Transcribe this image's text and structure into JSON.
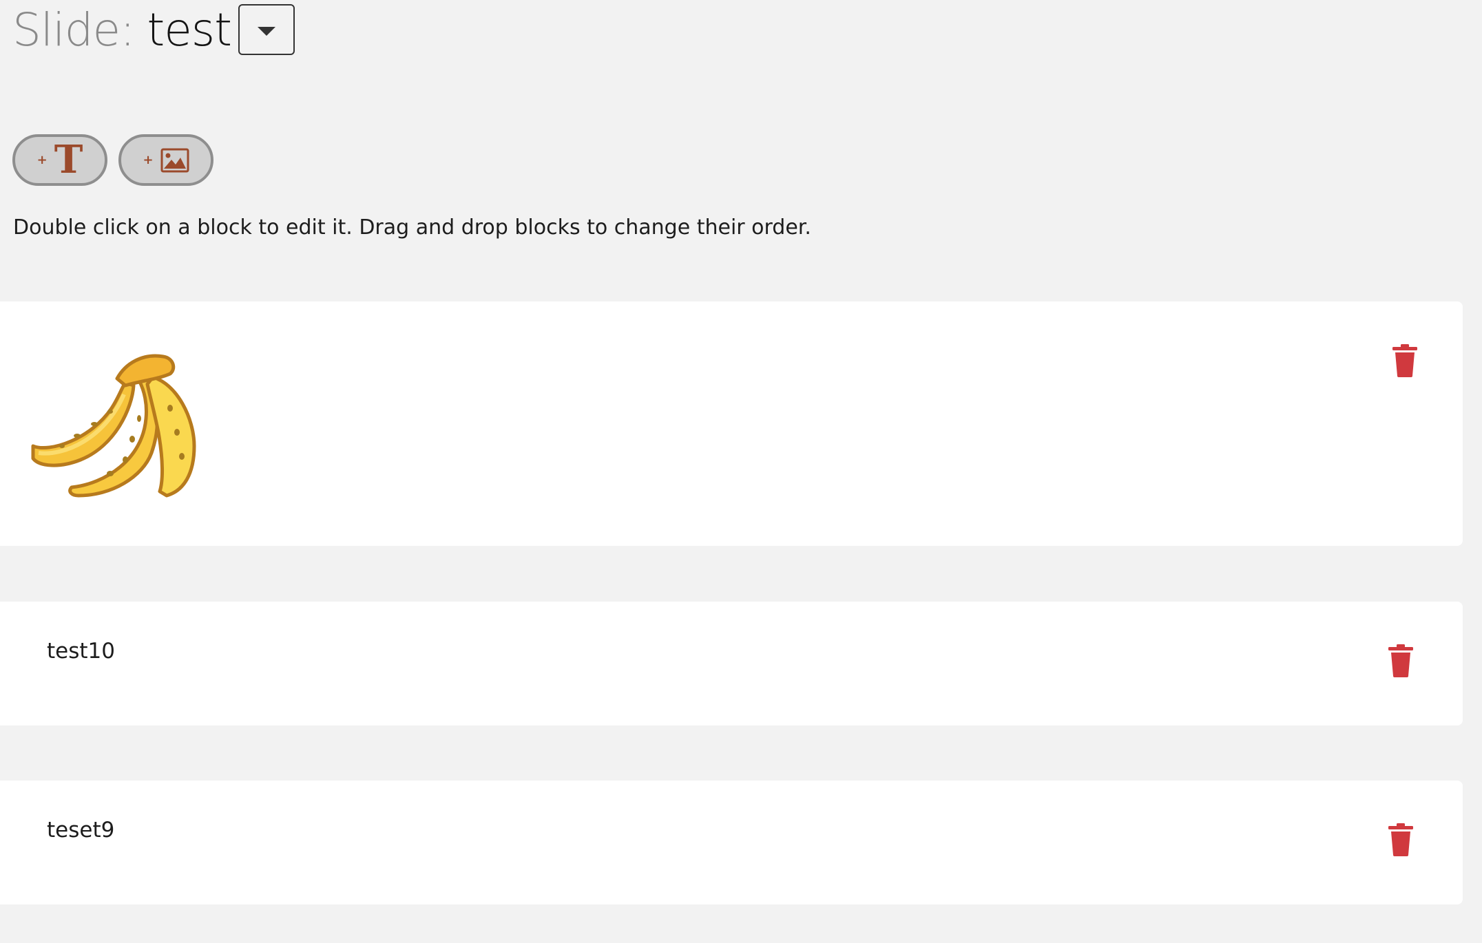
{
  "header": {
    "slide_prefix": "Slide:",
    "slide_name": "test"
  },
  "toolbar": {
    "add_text_plus": "+",
    "add_text_glyph": "T",
    "add_image_plus": "+"
  },
  "instruction": "Double click on a block to edit it. Drag and drop blocks to change their order.",
  "blocks": [
    {
      "type": "image",
      "image_icon": "banana-bunch-icon"
    },
    {
      "type": "text",
      "text": "test10"
    },
    {
      "type": "text",
      "text": "teset9"
    }
  ],
  "colors": {
    "background": "#f2f2f2",
    "block_background": "#ffffff",
    "accent_brown": "#9b4a2b",
    "delete_red": "#d0393e"
  }
}
